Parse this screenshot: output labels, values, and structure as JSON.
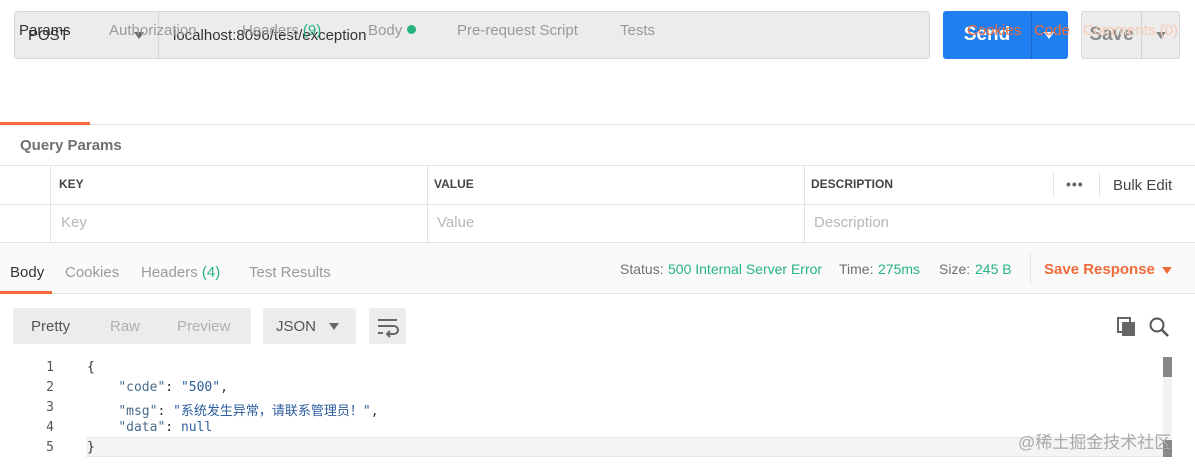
{
  "request": {
    "method": "POST",
    "url": "localhost:8096/test/exception",
    "send_label": "Send",
    "save_label": "Save"
  },
  "request_tabs": {
    "params": "Params",
    "authorization": "Authorization",
    "headers": "Headers",
    "headers_count": "(9)",
    "body": "Body",
    "prerequest": "Pre-request Script",
    "tests": "Tests",
    "cookies": "Cookies",
    "code": "Code",
    "comments": "Comments (0)"
  },
  "query_params": {
    "title": "Query Params",
    "columns": [
      "KEY",
      "VALUE",
      "DESCRIPTION"
    ],
    "placeholders": [
      "Key",
      "Value",
      "Description"
    ],
    "more": "•••",
    "bulk_edit": "Bulk Edit"
  },
  "response": {
    "tabs": {
      "body": "Body",
      "cookies": "Cookies",
      "headers": "Headers",
      "headers_count": "(4)",
      "test_results": "Test Results"
    },
    "status_label": "Status:",
    "status_value": "500 Internal Server Error",
    "time_label": "Time:",
    "time_value": "275ms",
    "size_label": "Size:",
    "size_value": "245 B",
    "save_response": "Save Response"
  },
  "format_toolbar": {
    "pretty": "Pretty",
    "raw": "Raw",
    "preview": "Preview",
    "format": "JSON"
  },
  "code_lines": [
    {
      "n": "1"
    },
    {
      "n": "2",
      "key": "\"code\"",
      "value": "\"500\""
    },
    {
      "n": "3",
      "key": "\"msg\"",
      "value": "\"系统发生异常，请联系管理员！\""
    },
    {
      "n": "4",
      "key": "\"data\"",
      "value": "null"
    },
    {
      "n": "5"
    }
  ],
  "watermark": "@稀土掘金技术社区",
  "icons": {
    "method_caret": "chevron-down-icon",
    "copy": "copy-icon",
    "search": "search-icon",
    "wrap": "wrap-lines-icon"
  },
  "colors": {
    "accent": "#1f7ef0",
    "orange": "#f06b3a",
    "green": "#26b47f"
  }
}
